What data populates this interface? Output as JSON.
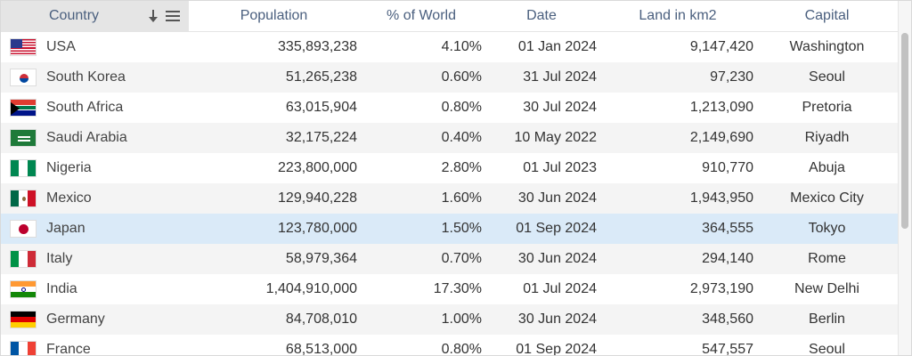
{
  "headers": {
    "country": "Country",
    "population": "Population",
    "pct_world": "% of World",
    "date": "Date",
    "land": "Land in km2",
    "capital": "Capital"
  },
  "rows": [
    {
      "flag": "flag-usa",
      "country": "USA",
      "population": "335,893,238",
      "pct": "4.10%",
      "date": "01 Jan 2024",
      "land": "9,147,420",
      "capital": "Washington"
    },
    {
      "flag": "flag-sk",
      "country": "South Korea",
      "population": "51,265,238",
      "pct": "0.60%",
      "date": "31 Jul 2024",
      "land": "97,230",
      "capital": "Seoul"
    },
    {
      "flag": "flag-za",
      "country": "South Africa",
      "population": "63,015,904",
      "pct": "0.80%",
      "date": "30 Jul 2024",
      "land": "1,213,090",
      "capital": "Pretoria"
    },
    {
      "flag": "flag-sa",
      "country": "Saudi Arabia",
      "population": "32,175,224",
      "pct": "0.40%",
      "date": "10 May 2022",
      "land": "2,149,690",
      "capital": "Riyadh"
    },
    {
      "flag": "flag-ng",
      "country": "Nigeria",
      "population": "223,800,000",
      "pct": "2.80%",
      "date": "01 Jul 2023",
      "land": "910,770",
      "capital": "Abuja"
    },
    {
      "flag": "flag-mx",
      "country": "Mexico",
      "population": "129,940,228",
      "pct": "1.60%",
      "date": "30 Jun 2024",
      "land": "1,943,950",
      "capital": "Mexico City"
    },
    {
      "flag": "flag-jp",
      "country": "Japan",
      "population": "123,780,000",
      "pct": "1.50%",
      "date": "01 Sep 2024",
      "land": "364,555",
      "capital": "Tokyo",
      "selected": true
    },
    {
      "flag": "flag-it",
      "country": "Italy",
      "population": "58,979,364",
      "pct": "0.70%",
      "date": "30 Jun 2024",
      "land": "294,140",
      "capital": "Rome"
    },
    {
      "flag": "flag-in",
      "country": "India",
      "population": "1,404,910,000",
      "pct": "17.30%",
      "date": "01 Jul 2024",
      "land": "2,973,190",
      "capital": "New Delhi"
    },
    {
      "flag": "flag-de",
      "country": "Germany",
      "population": "84,708,010",
      "pct": "1.00%",
      "date": "30 Jun 2024",
      "land": "348,560",
      "capital": "Berlin"
    },
    {
      "flag": "flag-fr",
      "country": "France",
      "population": "68,513,000",
      "pct": "0.80%",
      "date": "01 Sep 2024",
      "land": "547,557",
      "capital": "Seoul"
    }
  ],
  "colors": {
    "header_text": "#4a5f7e",
    "selected_row": "#daeaf8",
    "alt_row": "#f4f4f4"
  }
}
